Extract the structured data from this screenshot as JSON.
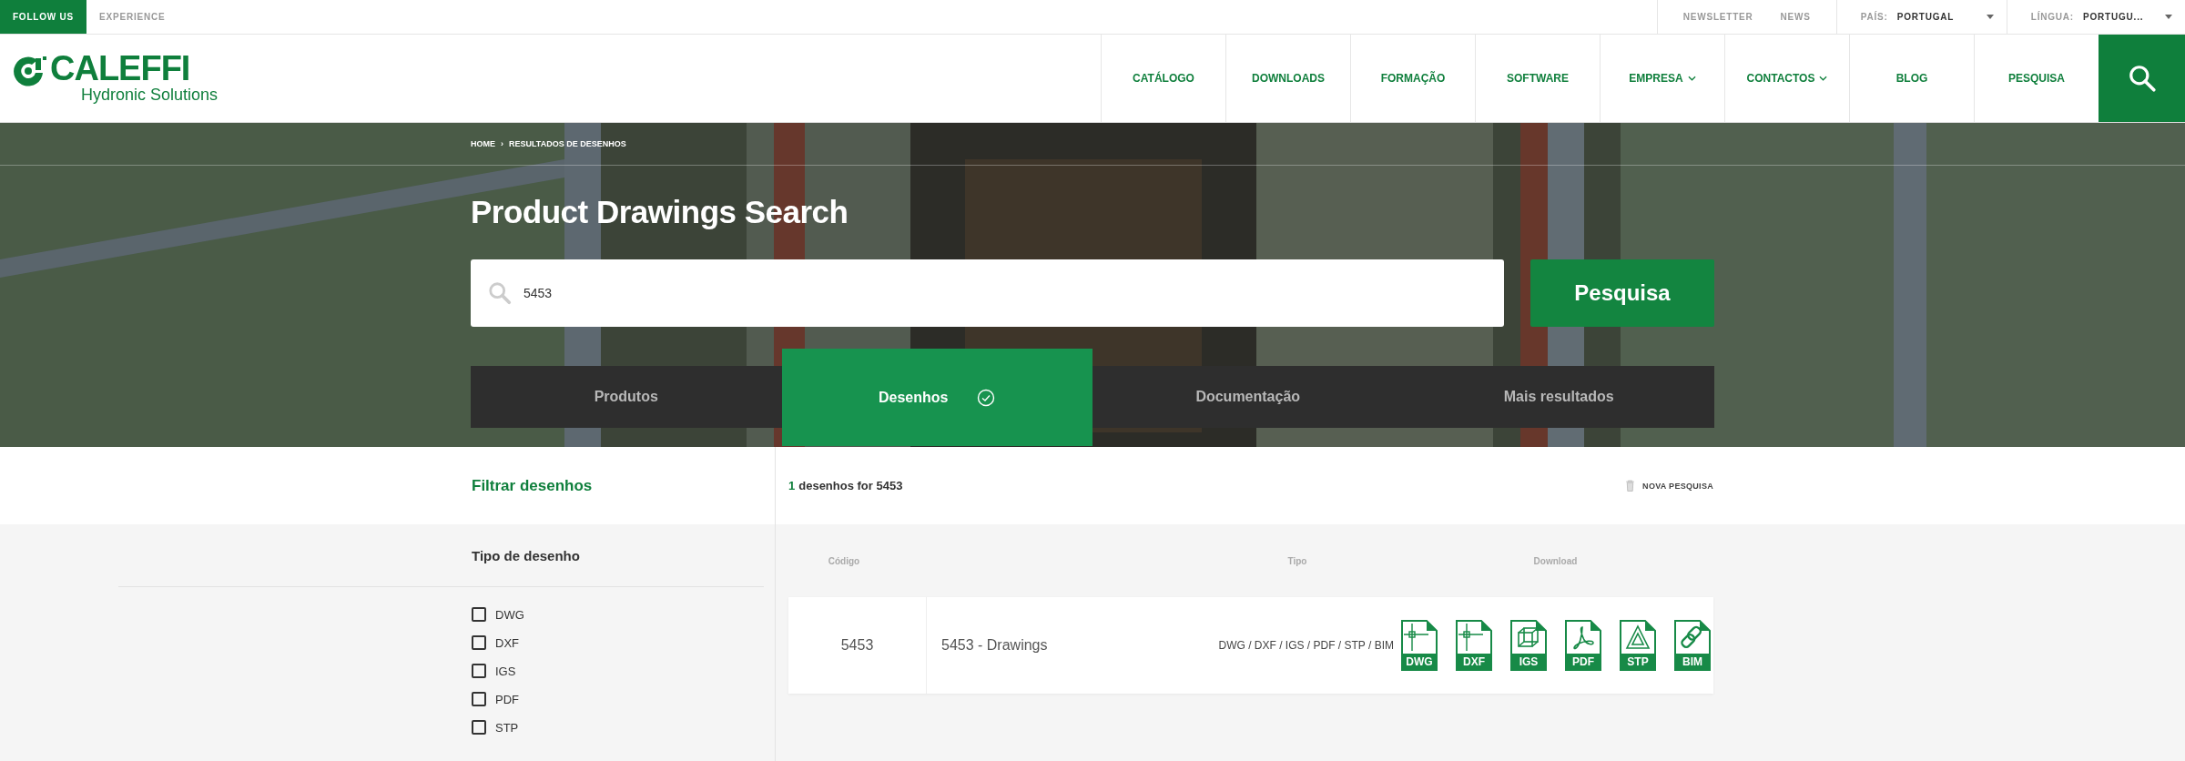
{
  "top_bar": {
    "follow_us": "FOLLOW US",
    "experience": "EXPERIENCE",
    "links": [
      "NEWSLETTER",
      "NEWS"
    ],
    "country": {
      "label": "PAÍS:",
      "value": "PORTUGAL"
    },
    "language": {
      "label": "LÍNGUA:",
      "value": "PORTUGU..."
    }
  },
  "logo": {
    "name": "CALEFFI",
    "tagline": "Hydronic Solutions"
  },
  "nav": [
    {
      "label": "CATÁLOGO",
      "dropdown": false
    },
    {
      "label": "DOWNLOADS",
      "dropdown": false
    },
    {
      "label": "FORMAÇÃO",
      "dropdown": false
    },
    {
      "label": "SOFTWARE",
      "dropdown": false
    },
    {
      "label": "EMPRESA",
      "dropdown": true
    },
    {
      "label": "CONTACTOS",
      "dropdown": true
    },
    {
      "label": "BLOG",
      "dropdown": false
    },
    {
      "label": "PESQUISA",
      "dropdown": false
    }
  ],
  "breadcrumb": {
    "items": [
      "HOME",
      "RESULTADOS DE DESENHOS"
    ],
    "separator": "›"
  },
  "title": "Product Drawings Search",
  "search": {
    "value": "5453",
    "button": "Pesquisa"
  },
  "tabs": [
    {
      "label": "Produtos",
      "selected": false
    },
    {
      "label": "Desenhos",
      "selected": true
    },
    {
      "label": "Documentação",
      "selected": false
    },
    {
      "label": "Mais resultados",
      "selected": false
    }
  ],
  "filter": {
    "title": "Filtrar desenhos",
    "group": "Tipo de desenho",
    "options": [
      {
        "label": "DWG",
        "checked": false
      },
      {
        "label": "DXF",
        "checked": false
      },
      {
        "label": "IGS",
        "checked": false
      },
      {
        "label": "PDF",
        "checked": false
      },
      {
        "label": "STP",
        "checked": false
      }
    ]
  },
  "results": {
    "count": "1",
    "summary": "desenhos for 5453",
    "new_search": "NOVA PESQUISA",
    "columns": [
      "Código",
      "Tipo",
      "Download"
    ],
    "rows": [
      {
        "code": "5453",
        "name": "5453 - Drawings",
        "types": "DWG / DXF / IGS / PDF / STP / BIM",
        "downloads": [
          {
            "label": "DWG",
            "kind": "dwg"
          },
          {
            "label": "DXF",
            "kind": "dxf"
          },
          {
            "label": "IGS",
            "kind": "igs"
          },
          {
            "label": "PDF",
            "kind": "pdf"
          },
          {
            "label": "STP",
            "kind": "stp"
          },
          {
            "label": "BIM",
            "kind": "bim"
          }
        ]
      }
    ]
  }
}
